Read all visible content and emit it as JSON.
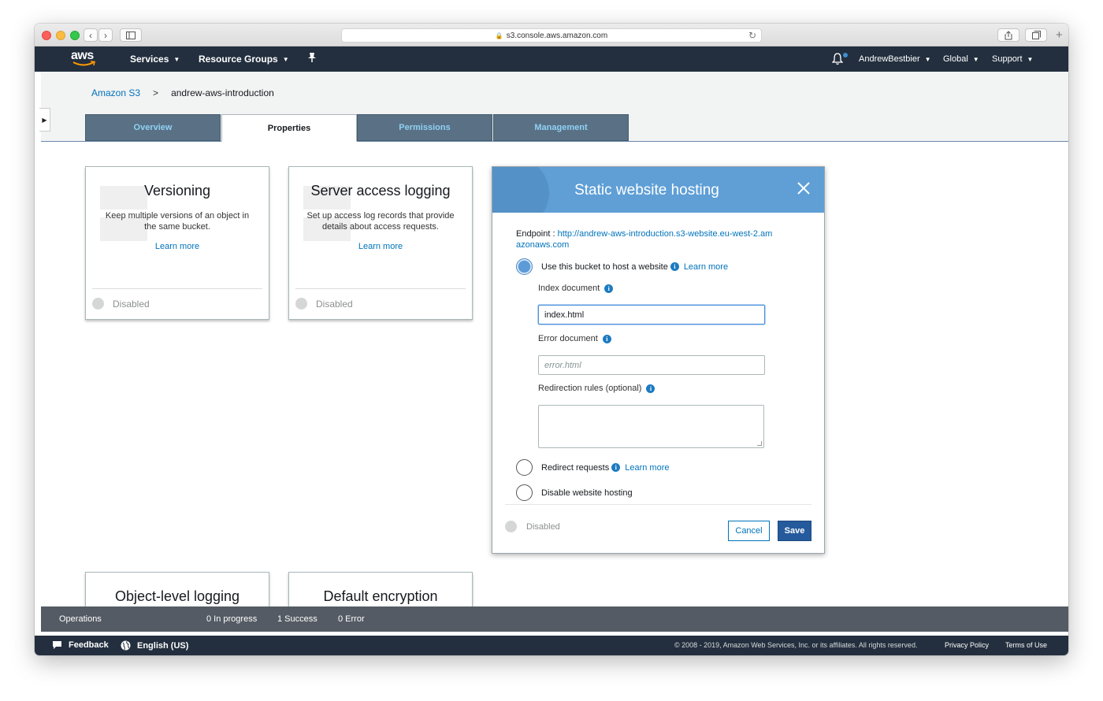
{
  "browser": {
    "url": "s3.console.aws.amazon.com"
  },
  "nav": {
    "logo": "aws",
    "services": "Services",
    "resource_groups": "Resource Groups",
    "user": "AndrewBestbier",
    "region": "Global",
    "support": "Support"
  },
  "breadcrumb": {
    "root": "Amazon S3",
    "separator": ">",
    "current": "andrew-aws-introduction"
  },
  "tabs": [
    {
      "label": "Overview",
      "active": false
    },
    {
      "label": "Properties",
      "active": true
    },
    {
      "label": "Permissions",
      "active": false
    },
    {
      "label": "Management",
      "active": false
    }
  ],
  "cards": [
    {
      "title": "Versioning",
      "description": "Keep multiple versions of an object in the same bucket.",
      "learn_more": "Learn more",
      "status": "Disabled"
    },
    {
      "title": "Server access logging",
      "description": "Set up access log records that provide details about access requests.",
      "learn_more": "Learn more",
      "status": "Disabled"
    },
    {
      "title": "Object-level logging"
    },
    {
      "title": "Default encryption"
    }
  ],
  "modal": {
    "title": "Static website hosting",
    "endpoint_label": "Endpoint : ",
    "endpoint_url": "http://andrew-aws-introduction.s3-website.eu-west-2.amazonaws.com",
    "option_host": "Use this bucket to host a website",
    "option_redirect": "Redirect requests",
    "option_disable": "Disable website hosting",
    "learn_more": "Learn more",
    "index_label": "Index document",
    "index_value": "index.html",
    "error_label": "Error document",
    "error_placeholder": "error.html",
    "redirection_label": "Redirection rules (optional)",
    "status": "Disabled",
    "cancel": "Cancel",
    "save": "Save",
    "selected_option": "host"
  },
  "operations": {
    "label": "Operations",
    "in_progress": "0 In progress",
    "success": "1 Success",
    "error": "0 Error"
  },
  "footer": {
    "feedback": "Feedback",
    "language": "English (US)",
    "copyright": "© 2008 - 2019, Amazon Web Services, Inc. or its affiliates. All rights reserved.",
    "privacy": "Privacy Policy",
    "terms": "Terms of Use"
  },
  "colors": {
    "nav_bg": "#232f3e",
    "tab_bg": "#5a7185",
    "modal_header": "#5f9fd6",
    "link": "#0073bb",
    "save_button": "#255a9c"
  }
}
